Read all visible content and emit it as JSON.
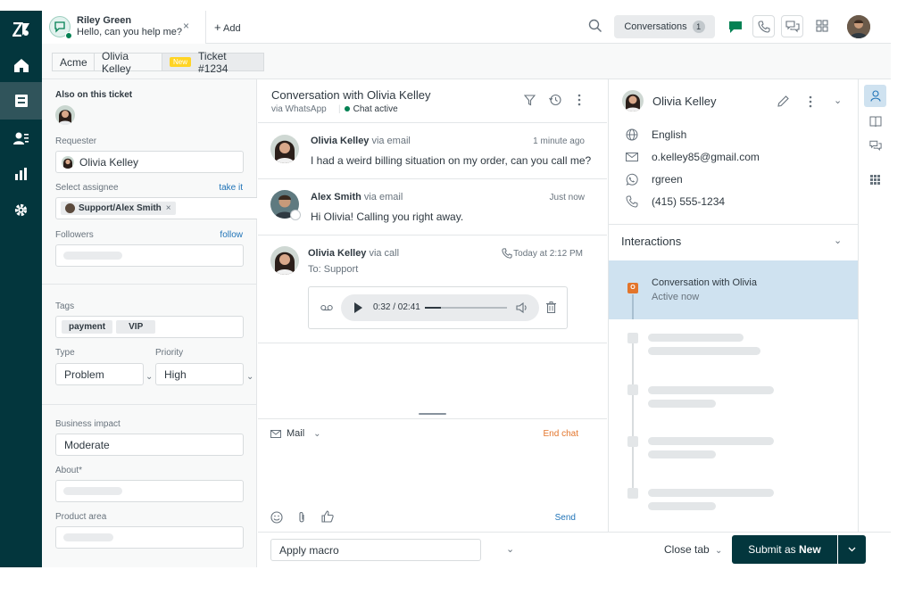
{
  "tab": {
    "name": "Riley Green",
    "message": "Hello, can you help me?",
    "close": "×",
    "add_label": "Add"
  },
  "topbar": {
    "conversations_label": "Conversations",
    "conversations_count": "1"
  },
  "breadcrumb": {
    "org": "Acme",
    "requester": "Olivia Kelley",
    "badge": "New",
    "ticket": "Ticket #1234"
  },
  "properties": {
    "also_on_ticket": "Also on this ticket",
    "requester_label": "Requester",
    "requester_value": "Olivia Kelley",
    "assignee_label": "Select assignee",
    "take_it": "take it",
    "assignee_value": "Support/Alex Smith",
    "followers_label": "Followers",
    "follow": "follow",
    "tags_label": "Tags",
    "tags": [
      "payment",
      "VIP"
    ],
    "type_label": "Type",
    "type_value": "Problem",
    "priority_label": "Priority",
    "priority_value": "High",
    "business_impact_label": "Business impact",
    "business_impact_value": "Moderate",
    "about_label": "About*",
    "product_area_label": "Product area"
  },
  "conversation": {
    "title": "Conversation with Olivia Kelley",
    "channel": "via WhatsApp",
    "status": "Chat active",
    "messages": [
      {
        "author": "Olivia Kelley",
        "via": "via email",
        "time": "1 minute ago",
        "text": "I had a weird billing situation on my order, can you call me?"
      },
      {
        "author": "Alex Smith",
        "via": "via email",
        "time": "Just now",
        "text": "Hi Olivia! Calling you right away."
      },
      {
        "author": "Olivia Kelley",
        "via": "via call",
        "time": "Today at 2:12 PM",
        "text": "To: Support"
      }
    ],
    "audio_time": "0:32 / 02:41",
    "audio_progress": 0.2
  },
  "composer": {
    "channel": "Mail",
    "end_chat": "End chat",
    "send": "Send"
  },
  "customer": {
    "name": "Olivia Kelley",
    "language": "English",
    "email": "o.kelley85@gmail.com",
    "whatsapp": "rgreen",
    "phone": "(415) 555-1234"
  },
  "interactions": {
    "heading": "Interactions",
    "active_title": "Conversation with Olivia",
    "active_status": "Active now",
    "active_badge": "O"
  },
  "footer": {
    "macro": "Apply macro",
    "close_tab": "Close tab",
    "submit_prefix": "Submit as ",
    "submit_status": "New"
  },
  "colors": {
    "nav": "#03363d",
    "accent_green": "#038153",
    "link_blue": "#1f73b7",
    "end_chat_orange": "#e3752b",
    "active_interaction": "#cfe2f0"
  }
}
